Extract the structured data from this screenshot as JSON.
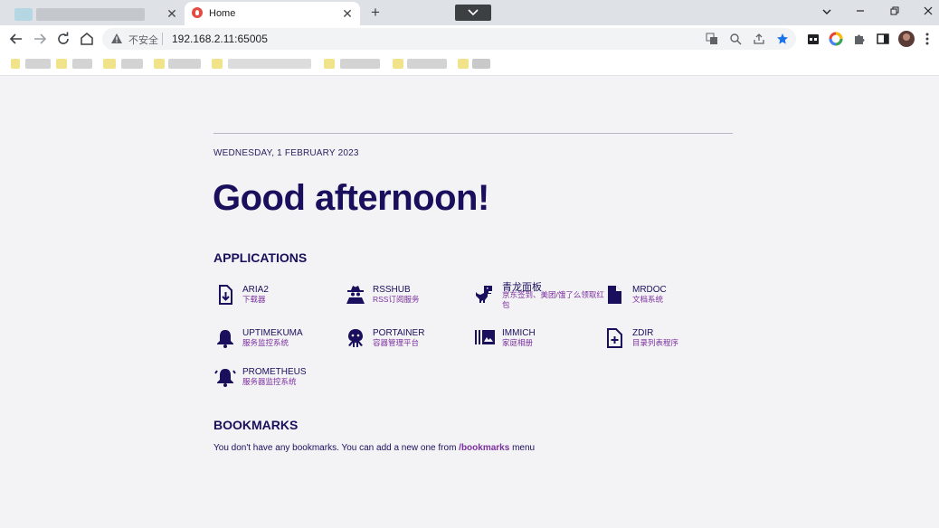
{
  "browser": {
    "active_tab_title": "Home",
    "not_secure_label": "不安全",
    "url": "192.168.2.11:65005"
  },
  "page": {
    "date": "WEDNESDAY, 1 FEBRUARY 2023",
    "greeting": "Good afternoon!",
    "applications_title": "APPLICATIONS",
    "applications": [
      {
        "name": "ARIA2",
        "desc": "下载器",
        "icon": "download-file-icon"
      },
      {
        "name": "RSSHUB",
        "desc": "RSS订阅服务",
        "icon": "user-secret-icon"
      },
      {
        "name": "青龙面板",
        "desc": "京东签到、美团/饿了么领取红包",
        "icon": "dinosaur-icon"
      },
      {
        "name": "MRDOC",
        "desc": "文档系统",
        "icon": "document-icon"
      },
      {
        "name": "UPTIMEKUMA",
        "desc": "服务监控系统",
        "icon": "bell-icon"
      },
      {
        "name": "PORTAINER",
        "desc": "容器管理平台",
        "icon": "octopus-icon"
      },
      {
        "name": "IMMICH",
        "desc": "家庭相册",
        "icon": "photo-library-icon"
      },
      {
        "name": "ZDIR",
        "desc": "目录列表程序",
        "icon": "file-plus-icon"
      },
      {
        "name": "PROMETHEUS",
        "desc": "服务器监控系统",
        "icon": "bell-ringing-icon"
      }
    ],
    "bookmarks_title": "BOOKMARKS",
    "bookmarks_text_before": "You don't have any bookmarks. You can add a new one from ",
    "bookmarks_link": "/bookmarks",
    "bookmarks_text_after": " menu"
  },
  "colors": {
    "primary": "#1a0f5c",
    "accent": "#7a2f9e",
    "background": "#f3f3f5"
  }
}
